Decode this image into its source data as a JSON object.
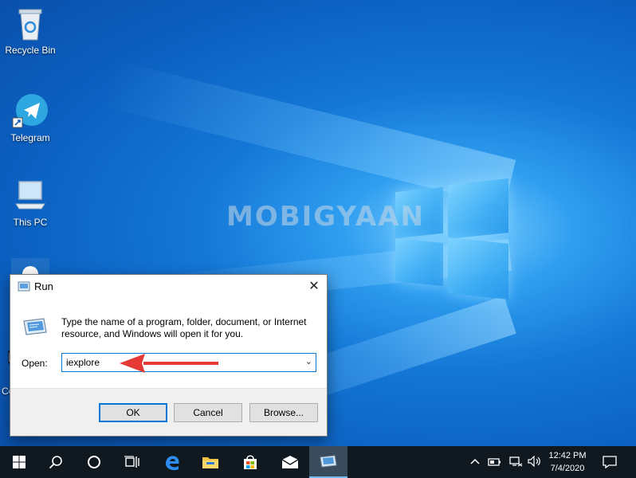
{
  "desktop": {
    "watermark": "MOBIGYAAN",
    "icons": [
      {
        "label": "Recycle Bin",
        "icon": "recycle-bin-icon"
      },
      {
        "label": "Telegram",
        "icon": "telegram-icon"
      },
      {
        "label": "This PC",
        "icon": "this-pc-icon"
      },
      {
        "label": "Co",
        "icon": "control-panel-icon"
      }
    ]
  },
  "run_dialog": {
    "title": "Run",
    "close_glyph": "✕",
    "message": "Type the name of a program, folder, document, or Internet resource, and Windows will open it for you.",
    "open_label": "Open:",
    "open_value": "iexplore",
    "dropdown_glyph": "⌄",
    "buttons": {
      "ok": "OK",
      "cancel": "Cancel",
      "browse": "Browse..."
    }
  },
  "annotation": {
    "color": "#e53935"
  },
  "taskbar": {
    "items": [
      "start-icon",
      "search-icon",
      "cortana-icon",
      "task-view-icon",
      "edge-icon",
      "file-explorer-icon",
      "store-icon",
      "mail-icon",
      "run-icon"
    ],
    "tray": {
      "time": "12:42 PM",
      "date": "7/4/2020"
    }
  },
  "colors": {
    "accent": "#0078d7",
    "taskbar": "#101820"
  }
}
